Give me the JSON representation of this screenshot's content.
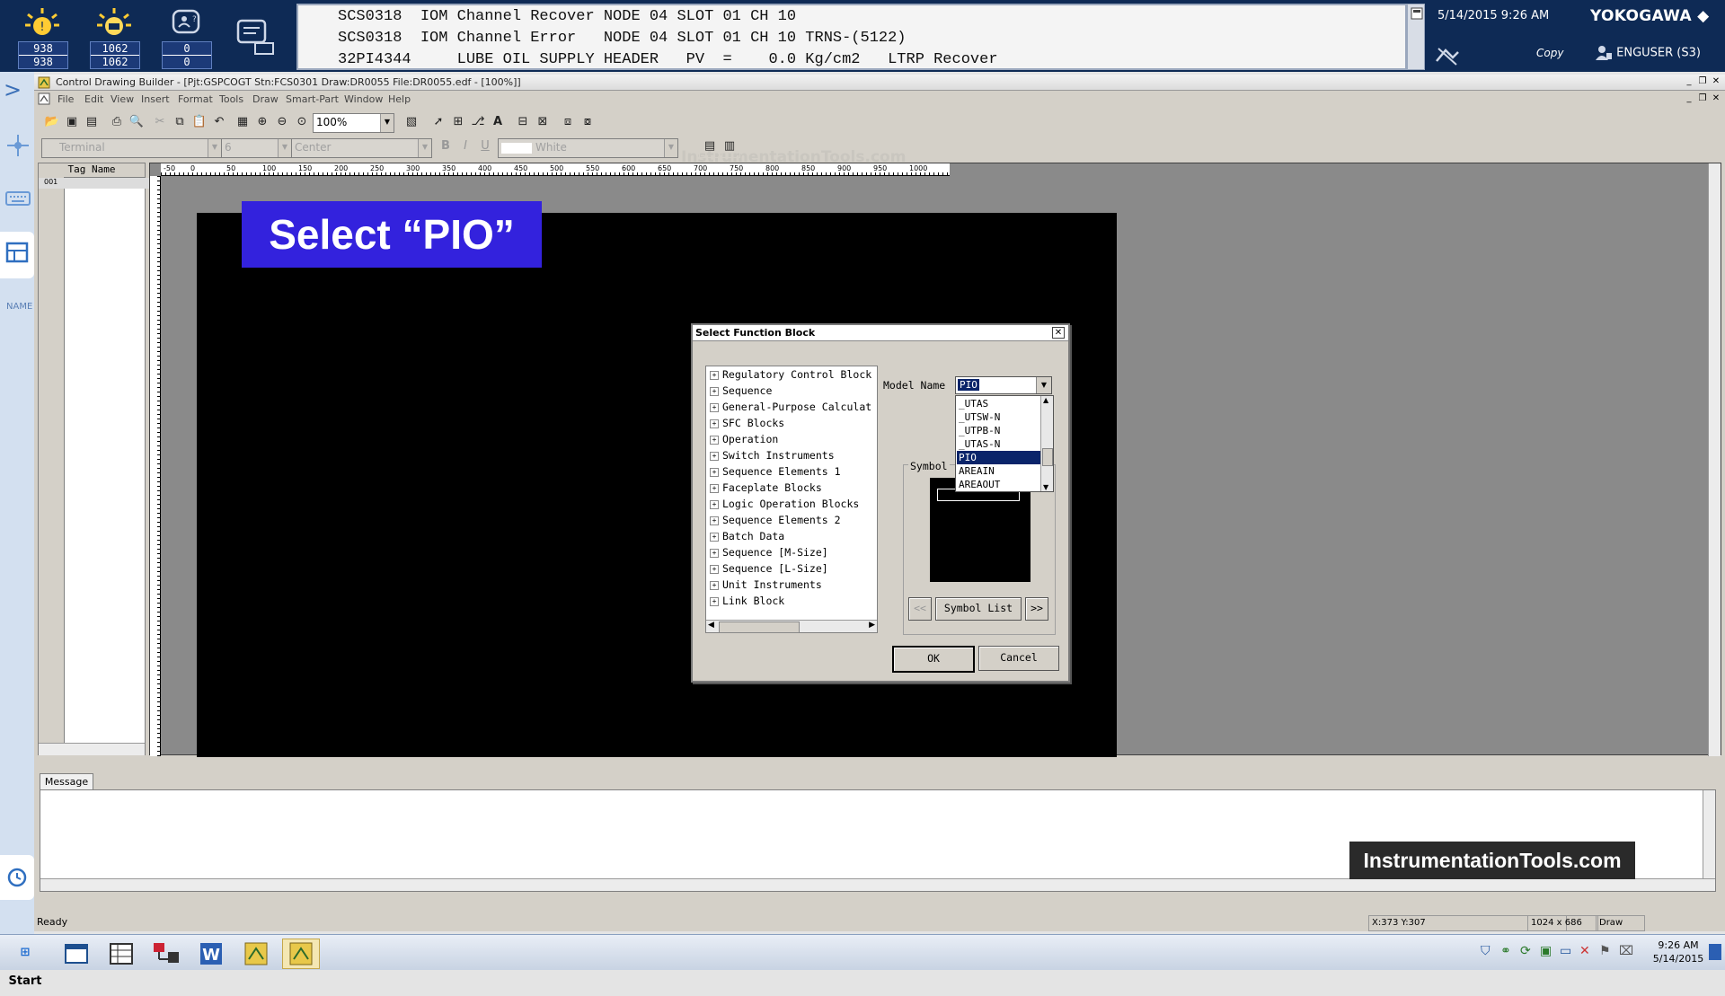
{
  "system_counts": [
    {
      "icon": "process-alarm-icon",
      "top": "938",
      "bottom": "938"
    },
    {
      "icon": "system-alarm-icon",
      "top": "1062",
      "bottom": "1062"
    },
    {
      "icon": "operator-guide-icon",
      "top": "0",
      "bottom": "0"
    }
  ],
  "alarms": [
    "SCS0318  IOM Channel Recover NODE 04 SLOT 01 CH 10",
    "SCS0318  IOM Channel Error   NODE 04 SLOT 01 CH 10 TRNS-(5122)",
    "32PI4344     LUBE OIL SUPPLY HEADER   PV  =    0.0 Kg/cm2   LTRP Recover"
  ],
  "header": {
    "datetime": "5/14/2015 9:26 AM",
    "brand": "YOKOGAWA ◆",
    "copy_label": "Copy",
    "user": "ENGUSER (S3)"
  },
  "dock": {
    "name_label": "NAME"
  },
  "app": {
    "title": "Control Drawing Builder - [Pjt:GSPCOGT Stn:FCS0301 Draw:DR0055 File:DR0055.edf - [100%]]",
    "menu": [
      "File",
      "Edit",
      "View",
      "Insert",
      "Format",
      "Tools",
      "Draw",
      "Smart-Part",
      "Window",
      "Help"
    ],
    "zoom": "100%",
    "font_name": "Terminal",
    "font_size": "6",
    "align": "Center",
    "color": "White",
    "watermark": "InstrumentationTools.com",
    "tag_header": "Tag Name",
    "tag_row_1": "001",
    "ruler_ticks": [
      "-50",
      "0",
      "50",
      "100",
      "150",
      "200",
      "250",
      "300",
      "350",
      "400",
      "450",
      "500",
      "550",
      "600",
      "650",
      "700",
      "750",
      "800",
      "850",
      "900",
      "950",
      "1000"
    ],
    "callout": "Select “PIO”",
    "message_tab": "Message",
    "brand_box": "InstrumentationTools.com",
    "status": {
      "ready": "Ready",
      "coords": "X:373 Y:307",
      "size": "1024 x 686",
      "mode": "Draw"
    }
  },
  "dialog": {
    "title": "Select Function Block",
    "tree": [
      "Regulatory Control Block",
      "Sequence",
      "General-Purpose Calculat",
      "SFC Blocks",
      "Operation",
      "Switch Instruments",
      "Sequence Elements 1",
      "Faceplate Blocks",
      "Logic Operation Blocks",
      "Sequence Elements 2",
      "Batch Data",
      "Sequence [M-Size]",
      "Sequence [L-Size]",
      "Unit Instruments",
      "Link Block"
    ],
    "model_label": "Model Name",
    "model_value": "PIO",
    "options": [
      "_UTAS",
      "_UTSW-N",
      "_UTPB-N",
      "_UTAS-N",
      "PIO",
      "AREAIN",
      "AREAOUT"
    ],
    "selected_option": "PIO",
    "symbol_label": "Symbol",
    "prev_label": "<<",
    "symbol_list_label": "Symbol List",
    "next_label": ">>",
    "ok_label": "OK",
    "cancel_label": "Cancel"
  },
  "taskbar": {
    "start": "Start",
    "time": "9:26 AM",
    "date": "5/14/2015"
  }
}
